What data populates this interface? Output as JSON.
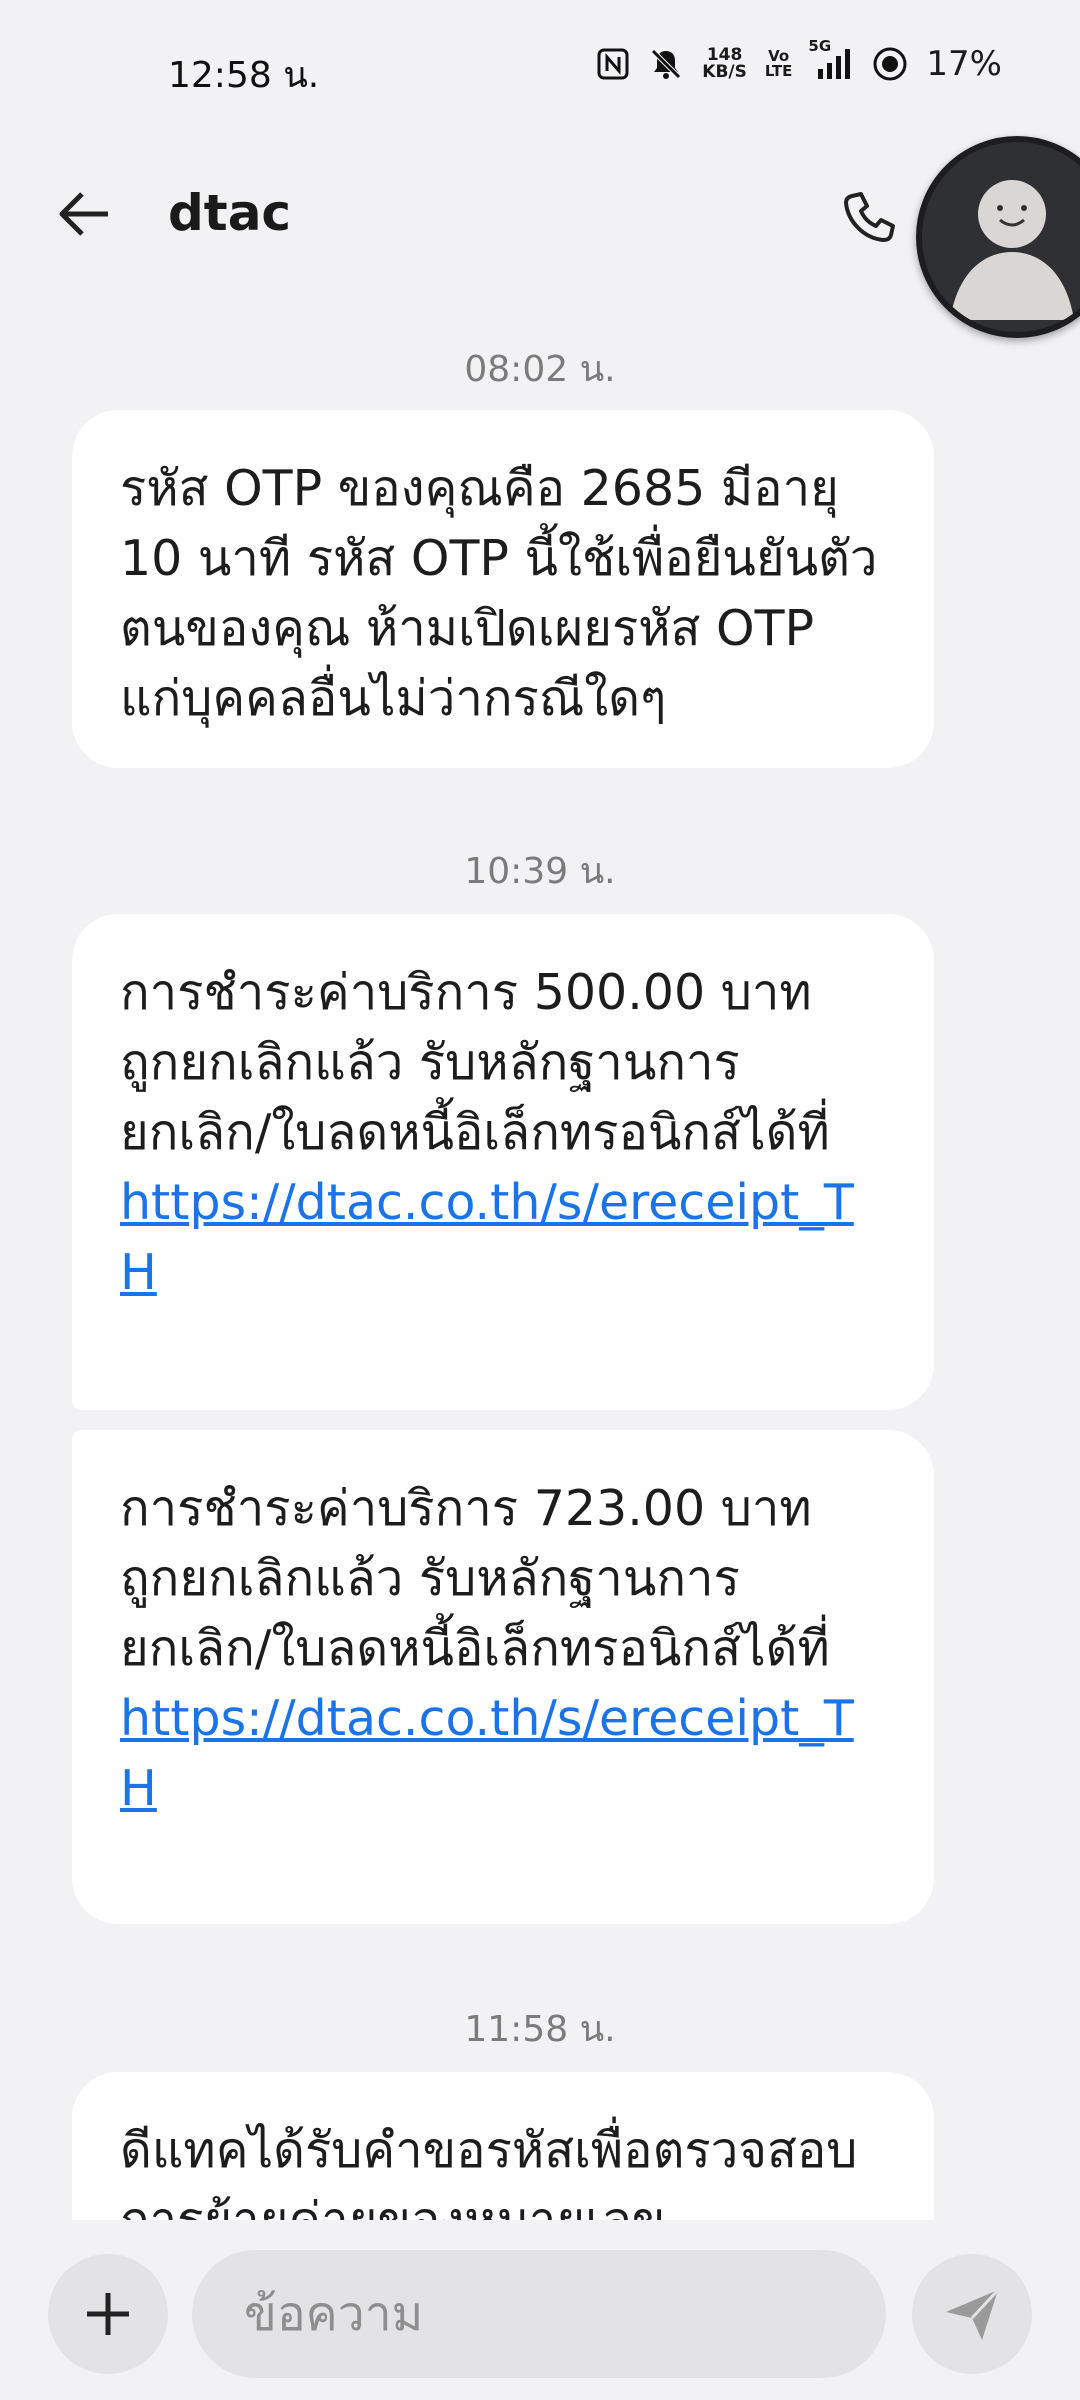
{
  "status_bar": {
    "time": "12:58 น.",
    "net_speed_value": "148",
    "net_speed_unit": "KB/S",
    "volte_top": "Vo",
    "volte_bottom": "LTE",
    "network": "5G",
    "battery": "17%",
    "icons": [
      "nfc-icon",
      "mute-icon",
      "signal-icon",
      "battery-icon"
    ]
  },
  "header": {
    "title": "dtac"
  },
  "messages": [
    {
      "timestamp": "08:02 น.",
      "text": "รหัส OTP ของคุณคือ 2685 มีอายุ 10 นาที รหัส OTP นี้ใช้เพื่อยืนยันตัวตนของคุณ ห้ามเปิดเผยรหัส OTP แก่บุคคลอื่นไม่ว่ากรณีใดๆ"
    },
    {
      "timestamp": "10:39 น.",
      "text": "การชำระค่าบริการ 500.00 บาท ถูกยกเลิกแล้ว รับหลักฐานการยกเลิก/ใบลดหนี้อิเล็กทรอนิกส์ได้ที่",
      "link": "https://dtac.co.th/s/ereceipt_TH"
    },
    {
      "text": "การชำระค่าบริการ 723.00 บาท ถูกยกเลิกแล้ว รับหลักฐานการยกเลิก/ใบลดหนี้อิเล็กทรอนิกส์ได้ที่",
      "link": "https://dtac.co.th/s/ereceipt_TH"
    },
    {
      "timestamp": "11:58 น.",
      "text": "ดีแทคได้รับคำขอรหัสเพื่อตรวจสอบการย้ายค่ายของหมายเลข"
    }
  ],
  "composer": {
    "placeholder": "ข้อความ"
  },
  "colors": {
    "background": "#f2f2f4",
    "bubble": "#ffffff",
    "link": "#1a73e8",
    "timestamp": "#7b7b7b"
  }
}
